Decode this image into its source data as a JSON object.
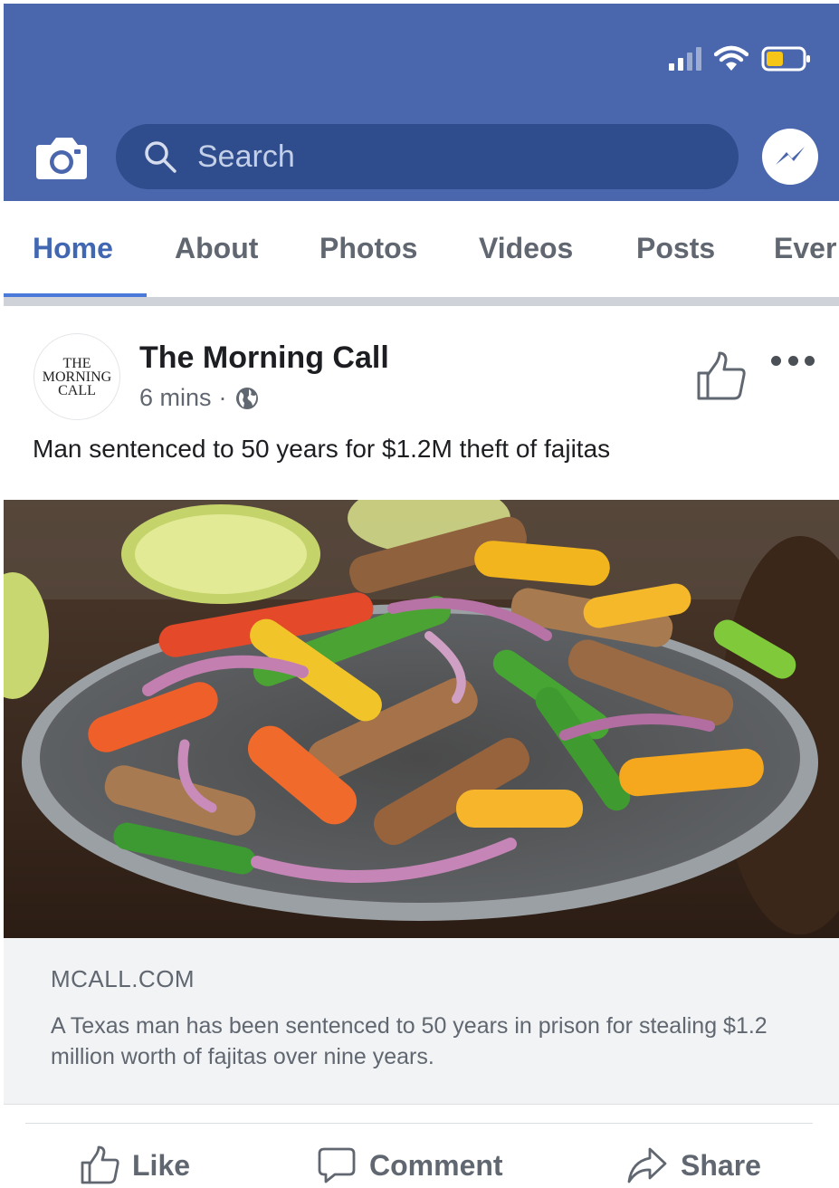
{
  "colors": {
    "header_bg": "#4a66ad",
    "search_bg": "#2f4c8c",
    "active_tab": "#4267b2",
    "inactive_text": "#616770",
    "battery": "#f5c518"
  },
  "header": {
    "search_placeholder": "Search",
    "icons": [
      "camera-icon",
      "search-icon",
      "messenger-icon",
      "signal-icon",
      "wifi-icon",
      "battery-icon"
    ]
  },
  "tabs": [
    {
      "label": "Home",
      "active": true
    },
    {
      "label": "About",
      "active": false
    },
    {
      "label": "Photos",
      "active": false
    },
    {
      "label": "Videos",
      "active": false
    },
    {
      "label": "Posts",
      "active": false
    },
    {
      "label": "Ever",
      "active": false
    }
  ],
  "post": {
    "avatar_text": [
      "THE",
      "MORNING",
      "CALL"
    ],
    "page_name": "The Morning Call",
    "time": "6 mins",
    "separator": "·",
    "text": "Man sentenced to 50 years for $1.2M theft of fajitas",
    "link_domain": "MCALL.COM",
    "link_description": "A Texas man has been sentenced to 50 years in prison for stealing $1.2 million worth of fajitas over nine years."
  },
  "actions": {
    "like": "Like",
    "comment": "Comment",
    "share": "Share"
  }
}
